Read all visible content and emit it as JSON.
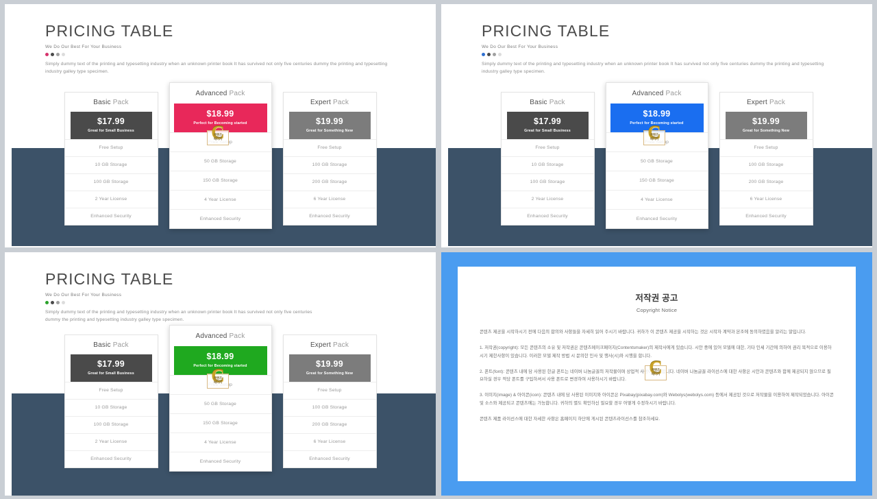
{
  "canvas": {
    "background": "#c9ced4"
  },
  "slides": [
    {
      "id": "top-left",
      "accent": "#e8285a",
      "band_color": "#3c5268",
      "dots": [
        "#d6336c",
        "#4a4a4a",
        "#a0a0a0",
        "#dcdcdc"
      ],
      "header": {
        "title": "PRICING TABLE",
        "subtitle": "We Do Our Best For Your Business"
      },
      "lede": "Simply dummy text of the printing  and typesetting industry  when an unknown printer  book It has survived not only five centuries  dummy  the printing  and typesetting industry galley type specimen.",
      "cards": [
        {
          "name": "Basic",
          "suffix": " Pack",
          "price": "$17.99",
          "note": "Great for Small Business",
          "header_color": "#4a4a4a",
          "features": [
            "Free Setup",
            "10 GB Storage",
            "100 GB Storage",
            "2 Year License",
            "Enhanced Security"
          ]
        },
        {
          "name": "Advanced",
          "suffix": " Pack",
          "price": "$18.99",
          "note": "Perfect for Becoming started",
          "header_color": "#e8285a",
          "features": [
            "Free Setup",
            "50 GB Storage",
            "150 GB Storage",
            "4 Year License",
            "Enhanced Security"
          ]
        },
        {
          "name": "Expert",
          "suffix": " Pack",
          "price": "$19.99",
          "note": "Great for Something New",
          "header_color": "#7c7c7c",
          "features": [
            "Free Setup",
            "100 GB Storage",
            "200 GB Storage",
            "6 Year License",
            "Enhanced Security"
          ]
        }
      ]
    },
    {
      "id": "top-right",
      "accent": "#1a6ef0",
      "band_color": "#3c5268",
      "dots": [
        "#2f6fd0",
        "#4a4a4a",
        "#a0a0a0",
        "#dcdcdc"
      ],
      "header": {
        "title": "PRICING TABLE",
        "subtitle": "We Do Our Best For Your Business"
      },
      "lede": "Simply dummy  text of the printing  and typesetting industry  when an unknown printer  book It has survived not only five centuries  dummy  the printing  and typesetting industry galley type specimen.",
      "cards": [
        {
          "name": "Basic",
          "suffix": " Pack",
          "price": "$17.99",
          "note": "Great for Small Business",
          "header_color": "#4a4a4a",
          "features": [
            "Free Setup",
            "10 GB Storage",
            "100 GB Storage",
            "2 Year License",
            "Enhanced Security"
          ]
        },
        {
          "name": "Advanced",
          "suffix": " Pack",
          "price": "$18.99",
          "note": "Perfect for Becoming started",
          "header_color": "#1a6ef0",
          "features": [
            "Free Setup",
            "50 GB Storage",
            "150 GB Storage",
            "4 Year License",
            "Enhanced Security"
          ]
        },
        {
          "name": "Expert",
          "suffix": " Pack",
          "price": "$19.99",
          "note": "Great for Something New",
          "header_color": "#7c7c7c",
          "features": [
            "Free Setup",
            "100 GB Storage",
            "200 GB Storage",
            "6 Year License",
            "Enhanced Security"
          ]
        }
      ]
    },
    {
      "id": "bottom-left",
      "accent": "#1fa91f",
      "band_color": "#3c5268",
      "dots": [
        "#2aa22a",
        "#4a4a4a",
        "#a0a0a0",
        "#dcdcdc"
      ],
      "header": {
        "title": "PRICING TABLE",
        "subtitle": "We Do Our Best For Your Business"
      },
      "lede": "Simply dummy  text of the printing  and typesetting industry  when an unknown printer  book It has survived not only five centuries  dummy  the printing  and typesetting industry galley type specimen.",
      "cards": [
        {
          "name": "Basic",
          "suffix": " Pack",
          "price": "$17.99",
          "note": "Great for Small Business",
          "header_color": "#4a4a4a",
          "features": [
            "Free Setup",
            "10 GB Storage",
            "100 GB Storage",
            "2 Year License",
            "Enhanced Security"
          ]
        },
        {
          "name": "Advanced",
          "suffix": " Pack",
          "price": "$18.99",
          "note": "Perfect for Becoming started",
          "header_color": "#1fa91f",
          "features": [
            "Free Setup",
            "50 GB Storage",
            "150 GB Storage",
            "4 Year License",
            "Enhanced Security"
          ]
        },
        {
          "name": "Expert",
          "suffix": " Pack",
          "price": "$19.99",
          "note": "Great for Something New",
          "header_color": "#7c7c7c",
          "features": [
            "Free Setup",
            "100 GB Storage",
            "200 GB Storage",
            "6 Year License",
            "Enhanced Security"
          ]
        }
      ]
    }
  ],
  "copyright_slide": {
    "frame_color": "#4a9cf0",
    "title": "저작권 공고",
    "subtitle": "Copyright Notice",
    "paragraphs": [
      "콘텐츠 제공을 시작하시기 전에 다음의 합의와 사항들을 자세히 읽어 주시기 바랍니다. 귀하가 이 콘텐츠 제공을 시작하는 것은 시작자 계약과 본조에 동의하였음을 알리는 말입니다.",
      "1. 저작권(copyright): 모든 콘텐츠의 소유 및 저작권은 콘텐츠메이크페이지(Contentsmaker)의 제작사에게 있습니다. 시안 중에 있어 모델에 대한, 기타 인세 기간에 의하여 권리 목적으로 이용하시기 제한사항이 있습니다. 이러한 모델 제작 방법 시 문의한 인사 및 행사(시)와 시행을 합니다.",
      "2. 폰트(font): 콘텐츠 내에 담 사용된 한글 폰트는 네이버 나눔글꼴의 저작물이며 상업적 사용이 가능합니다. 네이버 나눔글꼴 라이선스에 대한 사항은 시안과 콘텐츠와 함께 제공되지 않으므로 필요하실 경우 적당 폰트를 구입하셔서 사용 폰트로 변경하여 사용하시기 바랍니다.",
      "3. 이미지(image) & 아이콘(icon): 콘텐츠 내에 담 사용된 이미지와 아이콘은 Pixabay(pixabay.com)와 Webolys(webolys.com) 등에서 제공된 것으로 저작물을 이용하여 제작되었습니다. 아이콘 및 소스와 제공되고 콘텐츠에는 가능합니다. 귀하의 별도 확인하신 필요할 경우 어떻게 수정하시기 바랍니다.",
      "콘텐츠 제품 라이선스에 대한 자세한 사항은 홈페이지 하단에 게시된 콘텐츠라이선스를 참조하세요."
    ]
  },
  "watermark": {
    "letter": "C",
    "tag_line1": "콘텐츠",
    "tag_line2": "메이커"
  }
}
